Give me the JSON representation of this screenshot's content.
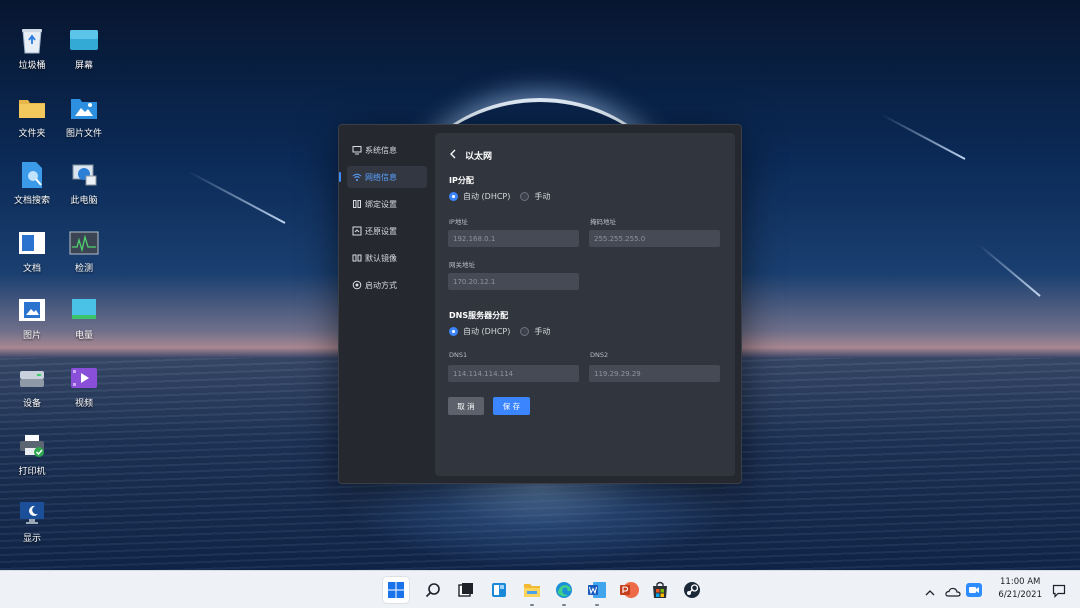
{
  "desktop": {
    "icons": [
      {
        "label": "垃圾桶",
        "icon": "recycle-bin-icon"
      },
      {
        "label": "屏幕",
        "icon": "screen-icon"
      },
      {
        "label": "文件夹",
        "icon": "folder-icon"
      },
      {
        "label": "图片文件",
        "icon": "picture-folder-icon"
      },
      {
        "label": "文档搜索",
        "icon": "document-search-icon"
      },
      {
        "label": "此电脑",
        "icon": "this-pc-icon"
      },
      {
        "label": "文档",
        "icon": "document-icon"
      },
      {
        "label": "检测",
        "icon": "monitor-check-icon"
      },
      {
        "label": "图片",
        "icon": "picture-icon"
      },
      {
        "label": "电量",
        "icon": "battery-icon"
      },
      {
        "label": "设备",
        "icon": "device-icon"
      },
      {
        "label": "视频",
        "icon": "video-icon"
      },
      {
        "label": "打印机",
        "icon": "printer-icon"
      },
      {
        "label": "显示",
        "icon": "display-icon"
      }
    ]
  },
  "window": {
    "nav": [
      {
        "label": "系统信息",
        "icon": "monitor-icon",
        "active": false
      },
      {
        "label": "网络信息",
        "icon": "wifi-icon",
        "active": true
      },
      {
        "label": "绑定设置",
        "icon": "bind-icon",
        "active": false
      },
      {
        "label": "还原设置",
        "icon": "restore-icon",
        "active": false
      },
      {
        "label": "默认镜像",
        "icon": "image-icon",
        "active": false
      },
      {
        "label": "启动方式",
        "icon": "power-icon",
        "active": false
      }
    ],
    "header": {
      "title": "以太网"
    },
    "ip_section": {
      "title": "IP分配",
      "options": [
        {
          "label": "自动 (DHCP)",
          "checked": true
        },
        {
          "label": "手动",
          "checked": false
        }
      ],
      "ip_label": "IP地址",
      "ip_value": "192.168.0.1",
      "mask_label": "掩码地址",
      "mask_value": "255.255.255.0",
      "gateway_label": "网关地址",
      "gateway_value": "170.20.12.1"
    },
    "dns_section": {
      "title": "DNS服务器分配",
      "options": [
        {
          "label": "自动 (DHCP)",
          "checked": true
        },
        {
          "label": "手动",
          "checked": false
        }
      ],
      "dns1_label": "DNS1",
      "dns1_value": "114.114.114.114",
      "dns2_label": "DNS2",
      "dns2_value": "119.29.29.29"
    },
    "buttons": {
      "cancel": "取 消",
      "save": "保 存"
    }
  },
  "taskbar": {
    "apps": [
      "start-icon",
      "search-icon",
      "task-view-icon",
      "widgets-icon",
      "file-explorer-icon",
      "edge-icon",
      "word-icon",
      "powerpoint-icon",
      "store-icon",
      "steam-icon"
    ],
    "tray": {
      "time": "11:00 AM",
      "date": "6/21/2021"
    }
  },
  "colors": {
    "accent": "#3b86ff",
    "cancel": "#5c616b",
    "panel": "#31353d",
    "window": "#25282f"
  }
}
